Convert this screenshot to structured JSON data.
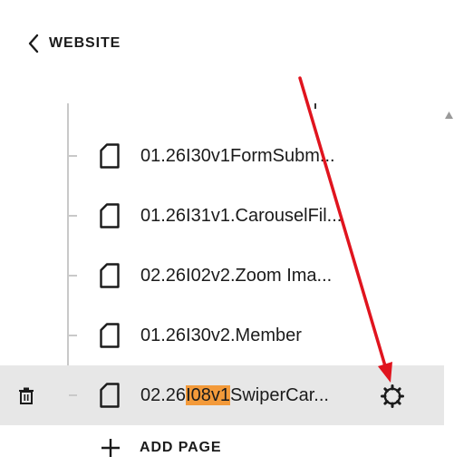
{
  "header": {
    "back_label": "WEBSITE"
  },
  "pages": [
    {
      "label_pre": "01.26I30v1FormSubm...",
      "label_hl": "",
      "label_post": ""
    },
    {
      "label_pre": "01.26I31v1.CarouselFil...",
      "label_hl": "",
      "label_post": ""
    },
    {
      "label_pre": "02.26I02v2.Zoom Ima...",
      "label_hl": "",
      "label_post": ""
    },
    {
      "label_pre": "01.26I30v2.Member",
      "label_hl": "",
      "label_post": ""
    },
    {
      "label_pre": "02.26",
      "label_hl": "I08v1",
      "label_post": "SwiperCar..."
    }
  ],
  "actions": {
    "add_page_label": "ADD PAGE"
  },
  "colors": {
    "highlight": "#f39a3a",
    "selected_row": "#e7e7e7",
    "annotation_arrow": "#e0141e"
  }
}
